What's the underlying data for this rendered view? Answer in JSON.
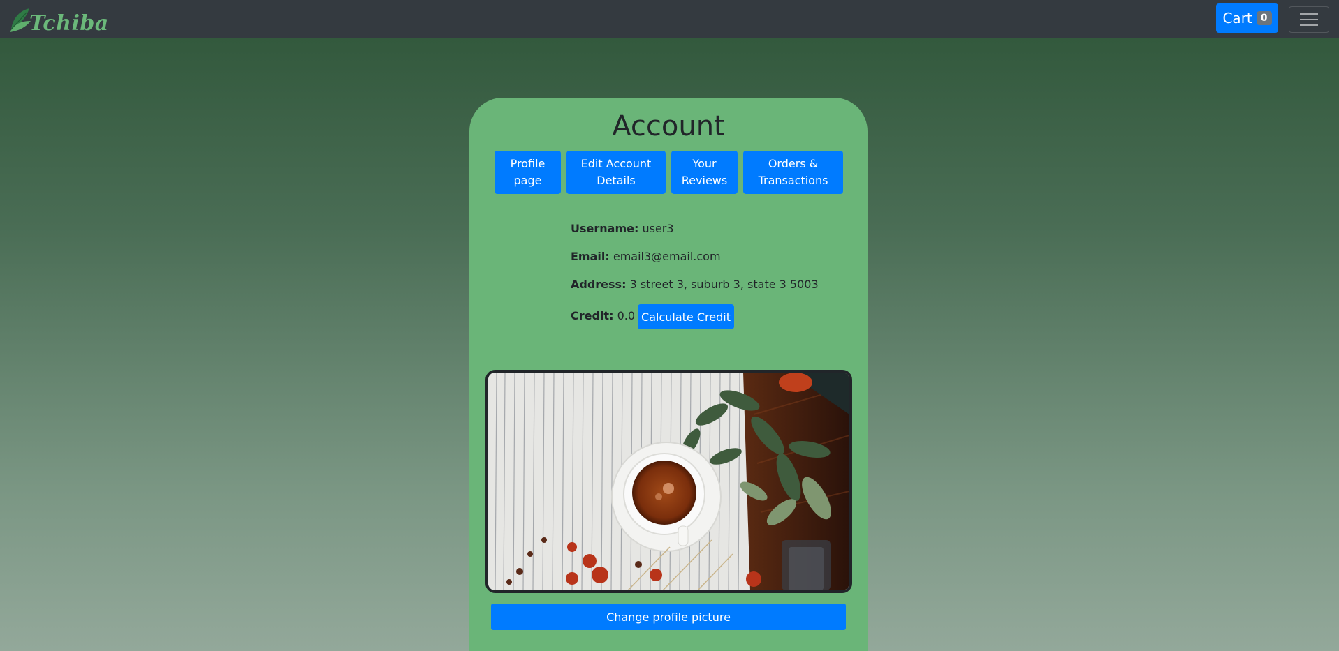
{
  "navbar": {
    "brand": "Tchiba",
    "cart_label": "Cart",
    "cart_count": "0"
  },
  "account": {
    "title": "Account",
    "tabs": [
      {
        "label": "Profile page"
      },
      {
        "label": "Edit Account Details"
      },
      {
        "label": "Your Reviews"
      },
      {
        "label": "Orders & Transactions"
      }
    ],
    "username_label": "Username:",
    "username": "user3",
    "email_label": "Email:",
    "email": "email3@email.com",
    "address_label": "Address:",
    "address": "3 street 3, suburb 3, state 3 5003",
    "credit_label": "Credit:",
    "credit": "0.0 //",
    "calc_credit_label": "Calculate Credit",
    "change_picture_label": "Change profile picture"
  },
  "colors": {
    "navbar": "#343a40",
    "brand": "#6bb87a",
    "card": "#6ab578",
    "primary": "#007bff"
  }
}
